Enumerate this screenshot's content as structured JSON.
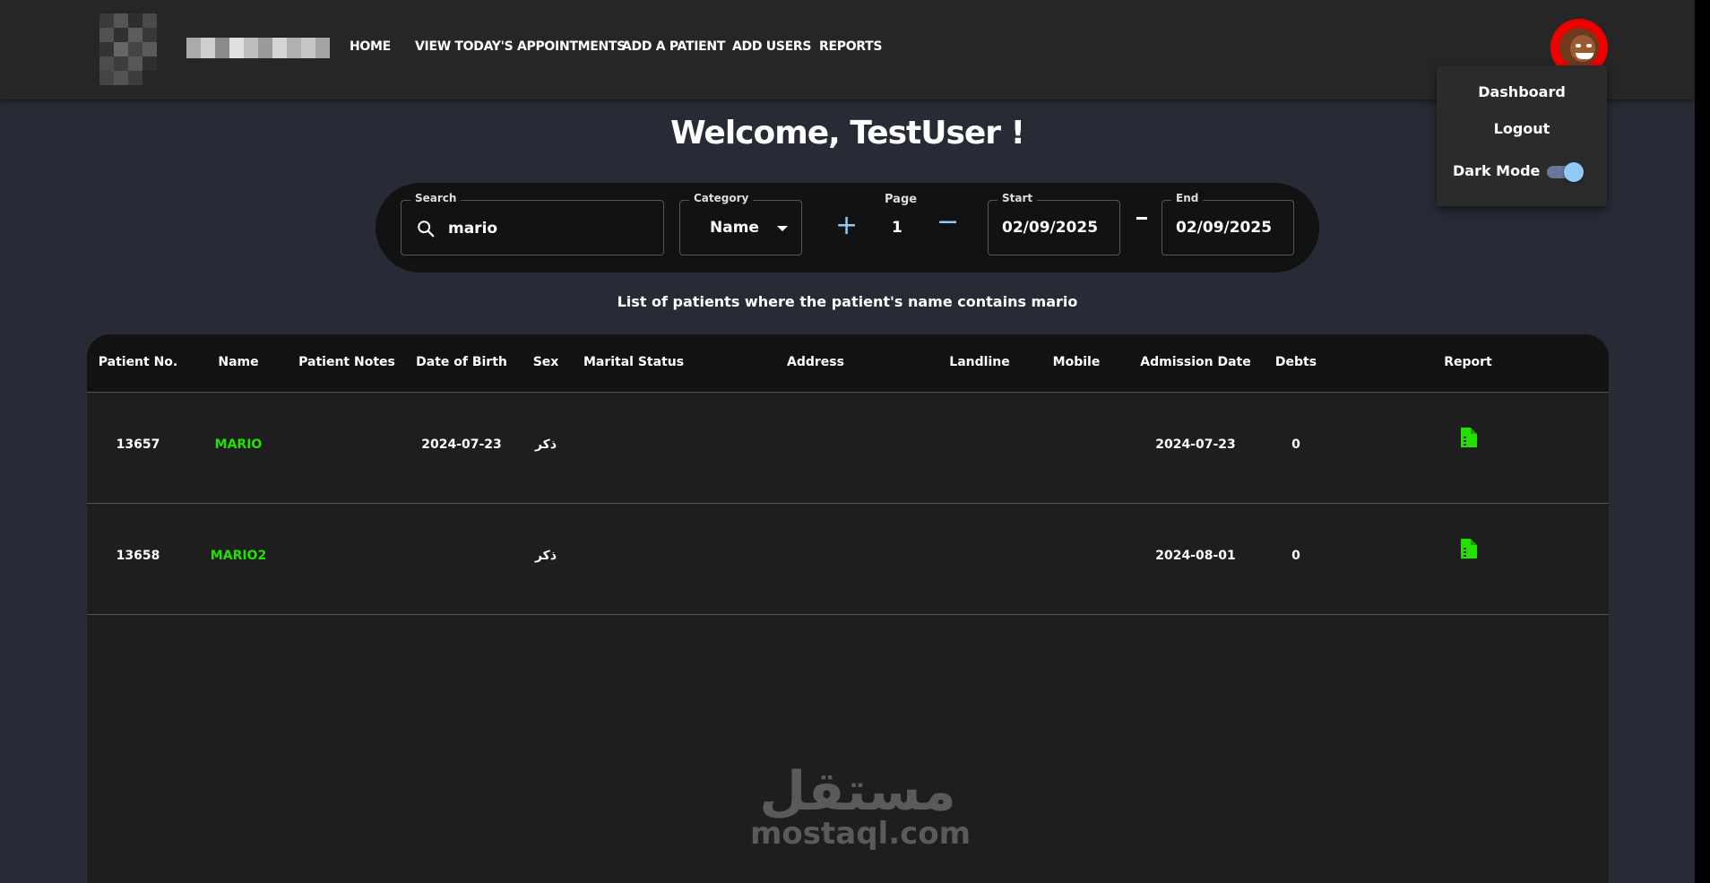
{
  "header": {
    "nav": [
      "HOME",
      "VIEW TODAY'S APPOINTMENTS",
      "ADD A PATIENT",
      "ADD USERS",
      "REPORTS"
    ]
  },
  "user_menu": {
    "dashboard": "Dashboard",
    "logout": "Logout",
    "dark_mode_label": "Dark Mode",
    "dark_mode_on": true
  },
  "welcome": "Welcome, TestUser !",
  "filters": {
    "search_label": "Search",
    "search_value": "mario",
    "category_label": "Category",
    "category_value": "Name",
    "increment_symbol": "+",
    "decrement_symbol": "−",
    "page_label": "Page",
    "page_value": "1",
    "start_label": "Start",
    "start_value": "02/09/2025",
    "end_label": "End",
    "end_value": "02/09/2025"
  },
  "list_caption": "List of patients where the patient's name contains mario",
  "table": {
    "columns": [
      "Patient No.",
      "Name",
      "Patient Notes",
      "Date of Birth",
      "Sex",
      "Marital Status",
      "Address",
      "Landline",
      "Mobile",
      "Admission Date",
      "Debts",
      "Report"
    ],
    "rows": [
      {
        "no": "13657",
        "name": "MARIO",
        "notes": "",
        "dob": "2024-07-23",
        "sex": "ذكر",
        "marital": "",
        "address": "",
        "landline": "",
        "mobile": "",
        "admission": "2024-07-23",
        "debts": "0",
        "report_icon": "file-report-icon"
      },
      {
        "no": "13658",
        "name": "MARIO2",
        "notes": "",
        "dob": "",
        "sex": "ذكر",
        "marital": "",
        "address": "",
        "landline": "",
        "mobile": "",
        "admission": "2024-08-01",
        "debts": "0",
        "report_icon": "file-report-icon"
      }
    ]
  },
  "watermark": {
    "arabic": "مستقل",
    "latin": "mostaql.com"
  },
  "colors": {
    "accent": "#90caf9",
    "link_green": "#22e000",
    "avatar_ring": "#ef0000"
  }
}
